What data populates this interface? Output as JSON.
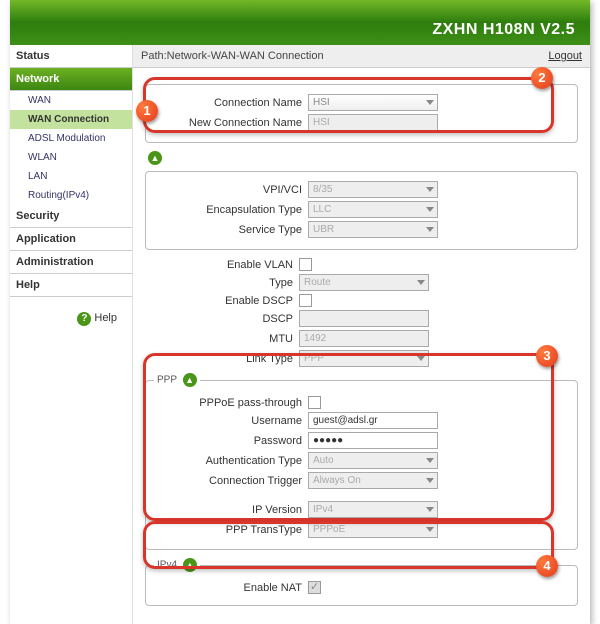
{
  "header": {
    "title": "ZXHN H108N V2.5"
  },
  "path": {
    "label": "Path:Network-WAN-WAN Connection",
    "logout": "Logout"
  },
  "sidebar": {
    "status": "Status",
    "network": "Network",
    "wan": "WAN",
    "wan_connection": "WAN Connection",
    "adsl_mod": "ADSL Modulation",
    "wlan": "WLAN",
    "lan": "LAN",
    "routing": "Routing(IPv4)",
    "security": "Security",
    "application": "Application",
    "administration": "Administration",
    "help": "Help"
  },
  "help_label": "Help",
  "section_conn": {
    "connection_name_label": "Connection Name",
    "connection_name_value": "HSI",
    "new_connection_name_label": "New Connection Name",
    "new_connection_name_value": "HSI"
  },
  "section_main": {
    "vpi_vci_label": "VPI/VCI",
    "vpi_vci_value": "8/35",
    "encap_label": "Encapsulation Type",
    "encap_value": "LLC",
    "service_label": "Service Type",
    "service_value": "UBR",
    "enable_vlan_label": "Enable VLAN",
    "type_label": "Type",
    "type_value": "Route",
    "enable_dscp_label": "Enable DSCP",
    "dscp_label": "DSCP",
    "dscp_value": "",
    "mtu_label": "MTU",
    "mtu_value": "1492",
    "link_label": "Link Type",
    "link_value": "PPP"
  },
  "section_ppp": {
    "legend": "PPP",
    "passthrough_label": "PPPoE pass-through",
    "username_label": "Username",
    "username_value": "guest@adsl.gr",
    "password_label": "Password",
    "password_value": "●●●●●",
    "auth_label": "Authentication Type",
    "auth_value": "Auto",
    "trigger_label": "Connection Trigger",
    "trigger_value": "Always On",
    "ipver_label": "IP Version",
    "ipver_value": "IPv4",
    "transtype_label": "PPP TransType",
    "transtype_value": "PPPoE"
  },
  "section_ipv4": {
    "legend": "IPv4",
    "enable_nat_label": "Enable NAT"
  },
  "badges": {
    "b1": "1",
    "b2": "2",
    "b3": "3",
    "b4": "4"
  }
}
